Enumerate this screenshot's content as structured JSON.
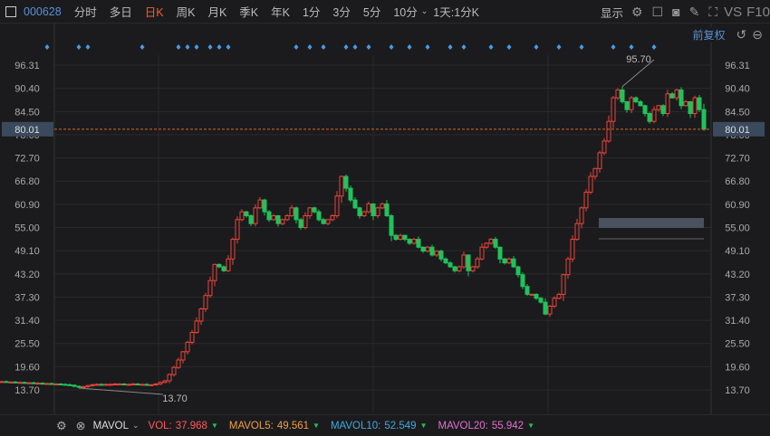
{
  "toolbar": {
    "code": "000628",
    "tabs": [
      "分时",
      "多日",
      "日K",
      "周K",
      "月K",
      "季K",
      "年K",
      "1分",
      "3分",
      "5分",
      "10分"
    ],
    "active": "日K",
    "period_select": "1天:1分K",
    "display_label": "显示",
    "vs_label": "VS",
    "f10_label": "F10"
  },
  "sub": {
    "adjust_label": "前复权"
  },
  "indicator": {
    "name": "MAVOL",
    "vol_label": "VOL:",
    "vol": "37.968",
    "ma5_label": "MAVOL5:",
    "ma5": "49.561",
    "ma10_label": "MAVOL10:",
    "ma10": "52.549",
    "ma20_label": "MAVOL20:",
    "ma20": "55.942",
    "colors": {
      "vol": "#ff5a5a",
      "ma5": "#f0a040",
      "ma10": "#3fa9e0",
      "ma20": "#e070d0"
    }
  },
  "chart_data": {
    "type": "candlestick",
    "y_ticks": [
      "96.31",
      "90.40",
      "84.50",
      "78.60",
      "72.70",
      "66.80",
      "60.90",
      "55.00",
      "49.10",
      "43.20",
      "37.30",
      "31.40",
      "25.50",
      "19.60",
      "13.70"
    ],
    "ylim": [
      13.7,
      96.31
    ],
    "current_price": "80.01",
    "high_label": "95.70",
    "low_label": "13.70",
    "closes": [
      15.9,
      15.8,
      15.8,
      15.7,
      15.7,
      15.6,
      15.6,
      15.5,
      15.5,
      15.4,
      15.4,
      15.3,
      15.3,
      15.2,
      15.2,
      15.1,
      15.0,
      14.9,
      14.6,
      14.4,
      14.5,
      14.8,
      15.0,
      15.1,
      15.0,
      15.1,
      15.1,
      15.2,
      15.2,
      15.1,
      15.1,
      15.2,
      15.1,
      15.1,
      14.9,
      15.0,
      15.2,
      15.6,
      16.0,
      17.6,
      19.4,
      21.3,
      23.4,
      25.8,
      28.3,
      31.2,
      34.3,
      37.7,
      41.5,
      45.6,
      45,
      44,
      47,
      52,
      57,
      59,
      58,
      56,
      60,
      62,
      59,
      57,
      58,
      56,
      57,
      58,
      60,
      57,
      55,
      58,
      60,
      59,
      57,
      56,
      57,
      58,
      63,
      68,
      65,
      62,
      60,
      58,
      59,
      61,
      58,
      60,
      61,
      58,
      53,
      52,
      53,
      52,
      51,
      52,
      50,
      49,
      50,
      48,
      49,
      47,
      46,
      45,
      44,
      45,
      48,
      44,
      45,
      47,
      50,
      51,
      52,
      50,
      47,
      46,
      47,
      45,
      43,
      40,
      38,
      38,
      37,
      36,
      33,
      35,
      37,
      38,
      43,
      47,
      52,
      56,
      60,
      64,
      68,
      70,
      74,
      77,
      82,
      88,
      90,
      87,
      85,
      88,
      87,
      86,
      84,
      82,
      85,
      86,
      84,
      89,
      88,
      90,
      86,
      87,
      84,
      88,
      85,
      80
    ],
    "event_markers": [
      12,
      19,
      21,
      33,
      41,
      43,
      45,
      48,
      50,
      52,
      67,
      70,
      73,
      78,
      80,
      83,
      88,
      92,
      96,
      101,
      104,
      110,
      114,
      120,
      125,
      130,
      137,
      141,
      146
    ]
  }
}
